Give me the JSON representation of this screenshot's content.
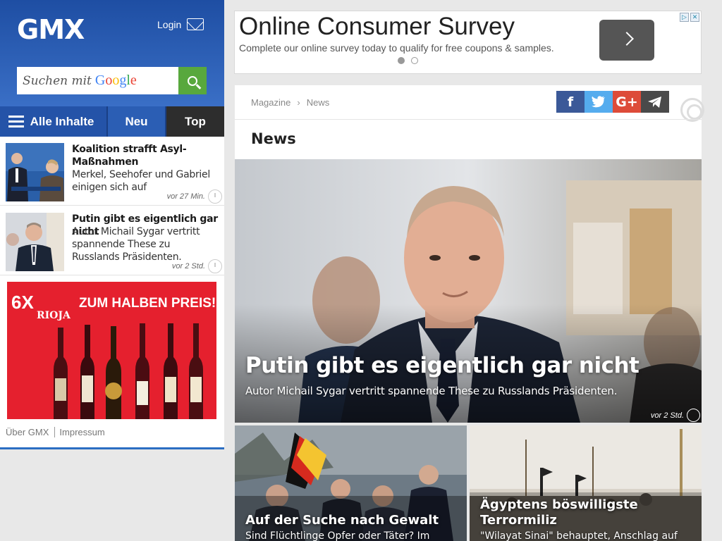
{
  "sidebar": {
    "logo": "GMX",
    "login": "Login",
    "search_placeholder": "Suchen mit",
    "search_brand": [
      "G",
      "o",
      "o",
      "g",
      "l",
      "e"
    ],
    "nav": {
      "all": "Alle Inhalte",
      "new": "Neu",
      "top": "Top"
    },
    "items": [
      {
        "title": "Koalition strafft Asyl-Maßnahmen",
        "desc": "Merkel, Seehofer und Gabriel einigen sich auf",
        "time": "vor 27 Min."
      },
      {
        "title": "Putin gibt es eigentlich gar nicht",
        "desc": "Autor Michail Sygar vertritt spannende These zu Russlands Präsidenten.",
        "time": "vor 2 Std."
      }
    ],
    "ad": {
      "count": "6X",
      "brand": "RIOJA",
      "headline": "ZUM HALBEN PREIS!"
    },
    "footer": {
      "about": "Über GMX",
      "imprint": "Impressum"
    }
  },
  "banner": {
    "title": "Online Consumer Survey",
    "subtitle": "Complete our online survey today to qualify for free coupons & samples."
  },
  "article": {
    "breadcrumb": [
      "Magazine",
      "News"
    ],
    "share": [
      "f",
      "t",
      "G+",
      "tg"
    ],
    "section": "News",
    "hero": {
      "title": "Putin gibt es eigentlich gar nicht",
      "desc": "Autor Michail Sygar vertritt spannende These zu Russlands Präsidenten.",
      "time": "vor 2 Std."
    },
    "tiles": [
      {
        "title": "Auf der Suche nach Gewalt",
        "desc": "Sind Flüchtlinge Opfer oder Täter? Im"
      },
      {
        "title": "Ägyptens böswilligste Terrormiliz",
        "desc": "\"Wilayat Sinai\" behauptet, Anschlag auf"
      }
    ]
  },
  "colors": {
    "header_blue": "#1e4ea3",
    "search_green": "#58a83d",
    "nav_top_dark": "#2d2d2d",
    "ad_red": "#e5202e",
    "facebook": "#3b5998",
    "twitter": "#55acee",
    "googleplus": "#dd4b39"
  }
}
